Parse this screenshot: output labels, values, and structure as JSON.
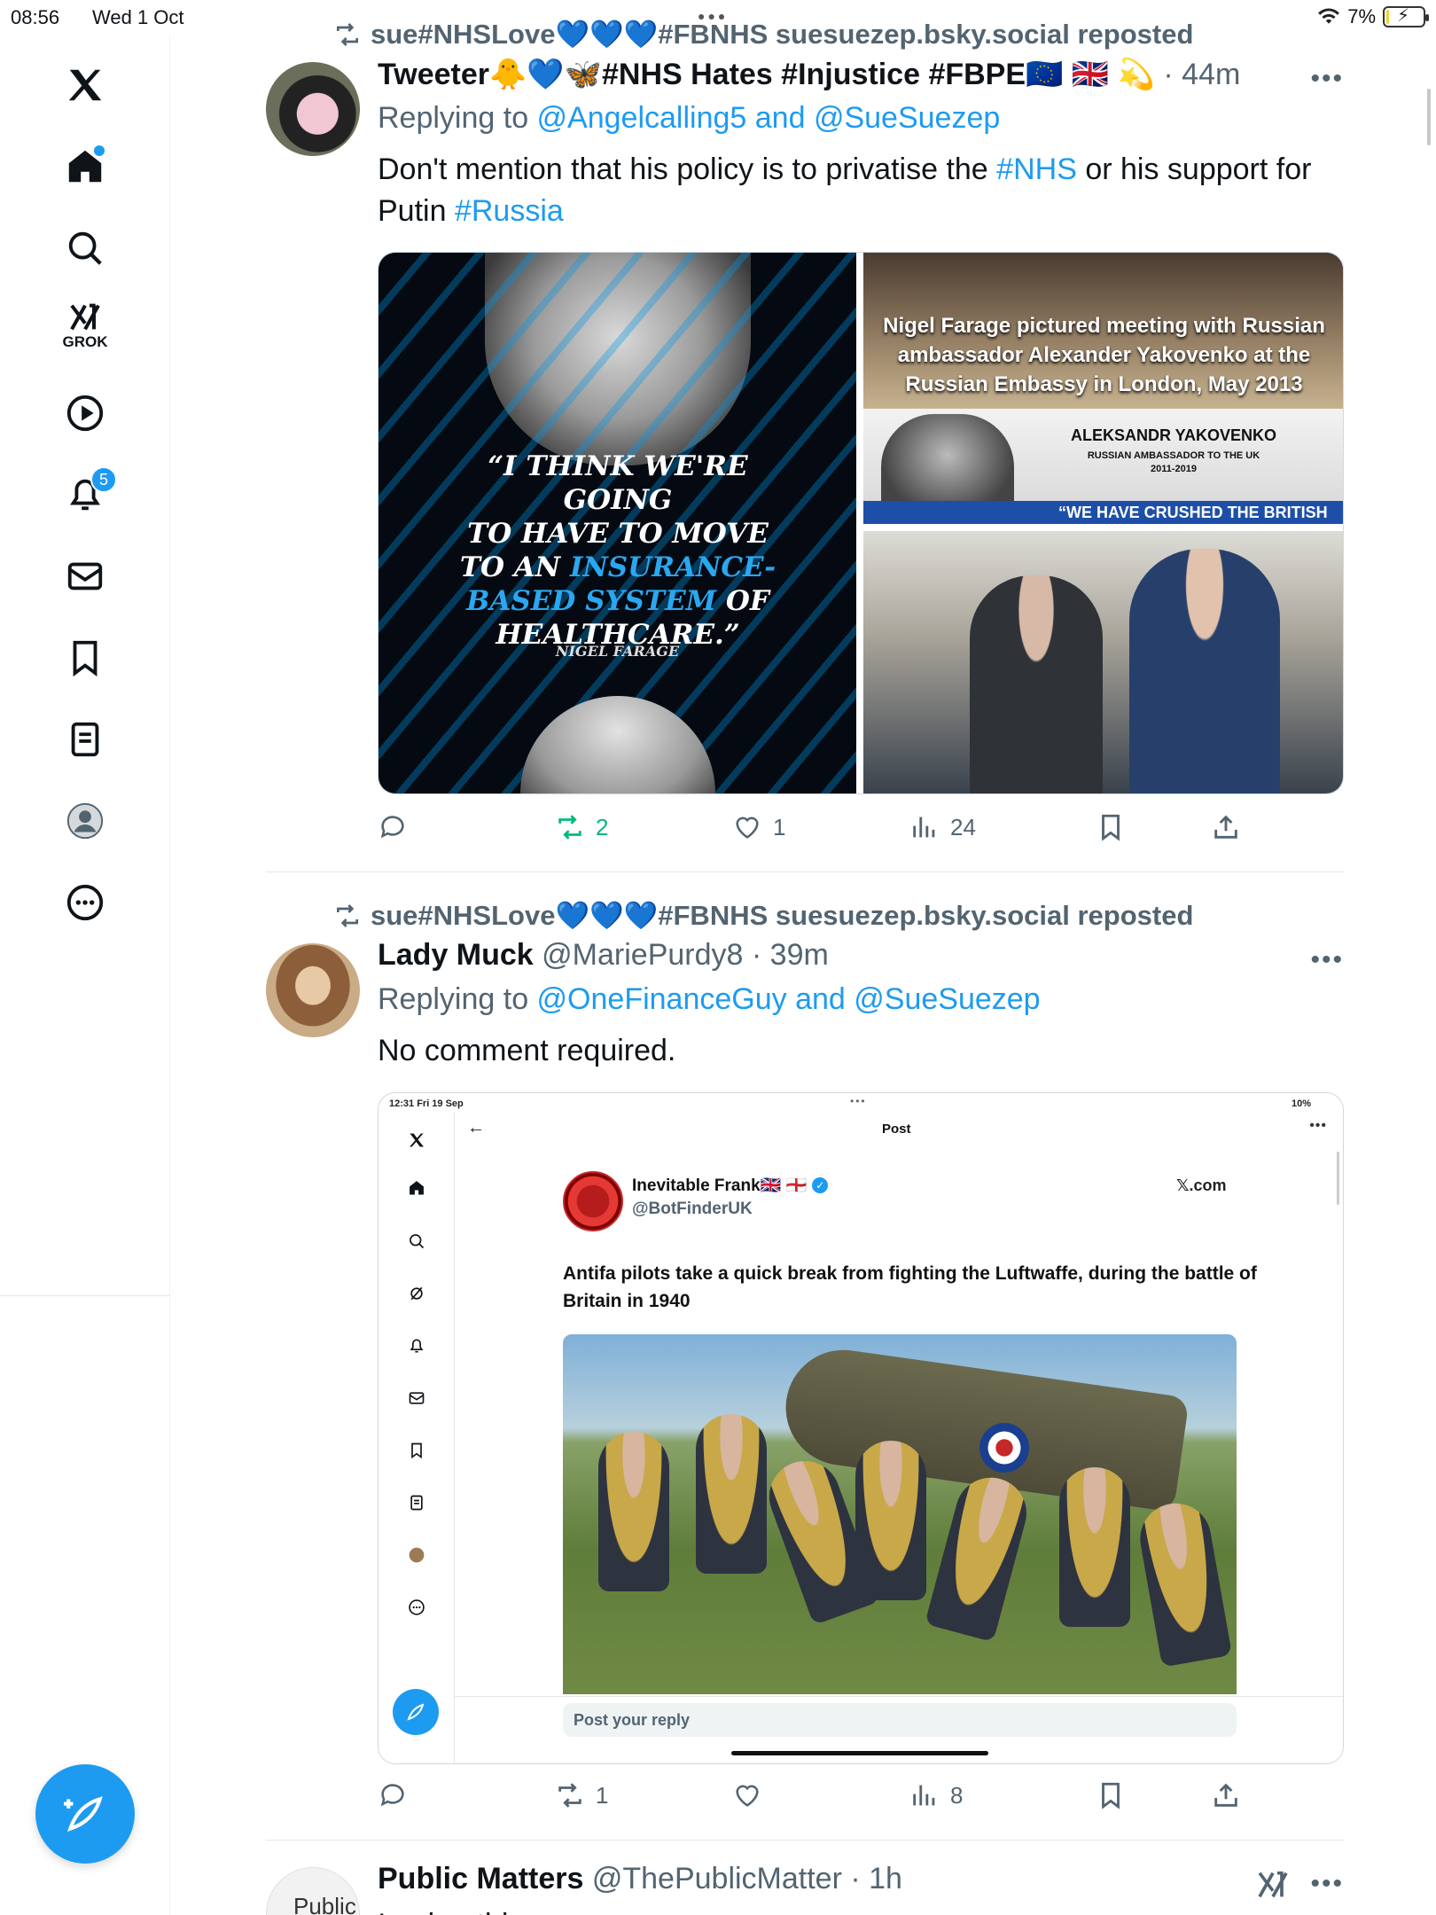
{
  "status_bar": {
    "time": "08:56",
    "date": "Wed 1 Oct",
    "battery": "7%",
    "battery_level": 0.07
  },
  "sidebar": {
    "items": [
      {
        "name": "x-logo",
        "icon": "x-logo-icon"
      },
      {
        "name": "home",
        "icon": "home-icon",
        "has_dot": true
      },
      {
        "name": "search",
        "icon": "search-icon"
      },
      {
        "name": "grok",
        "icon": "grok-icon",
        "label": "GROK"
      },
      {
        "name": "video",
        "icon": "play-icon"
      },
      {
        "name": "notifications",
        "icon": "bell-icon",
        "badge": "5"
      },
      {
        "name": "messages",
        "icon": "mail-icon"
      },
      {
        "name": "bookmarks",
        "icon": "bookmark-icon"
      },
      {
        "name": "lists",
        "icon": "list-icon"
      },
      {
        "name": "profile",
        "icon": "profile-icon"
      },
      {
        "name": "more",
        "icon": "more-icon"
      }
    ],
    "compose_icon": "compose-icon"
  },
  "feed": [
    {
      "repost_by": "sue#NHSLove💙💙💙#FBNHS suesuezep.bsky.social reposted",
      "display_name": "Tweeter🐥💙🦋#NHS Hates #Injustice #FBPE🇪🇺 🇬🇧 💫",
      "meta": "· 44m",
      "reply_prefix": "Replying to ",
      "reply_targets": "@Angelcalling5 and @SueSuezep",
      "text_parts": [
        "Don't mention that his policy is to privatise the ",
        "#NHS",
        " or his support for Putin ",
        "#Russia"
      ],
      "media": {
        "quote_line1": "“I THINK WE'RE GOING",
        "quote_line2": "TO HAVE TO MOVE",
        "quote_line3a": "TO AN ",
        "quote_line3b": "INSURANCE-",
        "quote_line4a": "BASED SYSTEM",
        "quote_line4b": " OF",
        "quote_line5": "HEALTHCARE.”",
        "attribution": "NIGEL FARAGE",
        "caption": "Nigel Farage pictured meeting with Russian ambassador Alexander Yakovenko at the Russian Embassy in London, May 2013",
        "ambassador_name": "ALEKSANDR YAKOVENKO",
        "ambassador_role": "RUSSIAN AMBASSADOR TO THE UK",
        "ambassador_years": "2011-2019",
        "ambassador_quote": "“WE HAVE CRUSHED THE BRITISH"
      },
      "actions": {
        "replies": "",
        "reposts": "2",
        "likes": "1",
        "views": "24"
      }
    },
    {
      "repost_by": "sue#NHSLove💙💙💙#FBNHS suesuezep.bsky.social reposted",
      "display_name": "Lady Muck",
      "handle": "@MariePurdy8",
      "meta": "· 39m",
      "reply_prefix": "Replying to ",
      "reply_targets": "@OneFinanceGuy and @SueSuezep",
      "text": "No comment required.",
      "embedded": {
        "status_time": "12:31  Fri 19 Sep",
        "status_battery": "10%",
        "title": "Post",
        "author": "Inevitable Frank🇬🇧 🏴󠁧󠁢󠁥󠁮󠁧󠁿",
        "author_handle": "@BotFinderUK",
        "source": "𝕏.com",
        "text": "Antifa pilots take a quick break from fighting the Luftwaffe, during the battle of Britain in 1940",
        "reply_placeholder": "Post your reply"
      },
      "actions": {
        "replies": "",
        "reposts": "1",
        "likes": "",
        "views": "8"
      }
    },
    {
      "display_name": "Public Matters",
      "handle": "@ThePublicMatter",
      "meta": "· 1h",
      "avatar_text": "Public",
      "text_partial": "I ... i ... thi..."
    }
  ]
}
